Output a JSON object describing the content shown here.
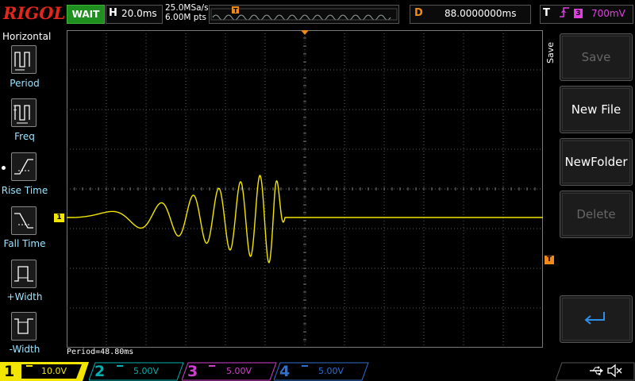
{
  "top_bar": {
    "logo": "RIGOL",
    "run_status": "WAIT",
    "h_label": "H",
    "timebase": "20.0ms",
    "sample_rate": "25.0MSa/s",
    "mem_depth": "6.00M pts",
    "d_label": "D",
    "delay": "88.0000000ms",
    "trigger_label": "T",
    "trigger_source": "3",
    "trigger_level": "700mV"
  },
  "left_menu": {
    "title": "Horizontal",
    "items": [
      {
        "label": "Period"
      },
      {
        "label": "Freq"
      },
      {
        "label": "Rise Time"
      },
      {
        "label": "Fall Time"
      },
      {
        "label": "+Width"
      },
      {
        "label": "-Width"
      }
    ]
  },
  "right_menu": {
    "tab_label": "Save",
    "buttons": [
      {
        "label": "Save",
        "enabled": false
      },
      {
        "label": "New File",
        "enabled": true
      },
      {
        "label": "NewFolder",
        "enabled": true
      },
      {
        "label": "Delete",
        "enabled": false
      },
      {
        "label": "",
        "icon": "return-arrow-icon",
        "enabled": true
      }
    ]
  },
  "waveform": {
    "channel_marker": "1",
    "trigger_marker": "T"
  },
  "measurement": "Period=48.80ms",
  "channels": [
    {
      "num": "1",
      "scale": "10.0V",
      "active": true
    },
    {
      "num": "2",
      "scale": "5.00V",
      "active": false
    },
    {
      "num": "3",
      "scale": "5.00V",
      "active": false
    },
    {
      "num": "4",
      "scale": "5.00V",
      "active": false
    }
  ],
  "colors": {
    "ch1": "#f2e600",
    "ch2": "#00b0b0",
    "ch3": "#d040d0",
    "ch4": "#2f6fd0",
    "trigger": "#f28a1a",
    "brand": "#e1261c",
    "run_status": "#1f8f1f"
  },
  "icons": [
    "usb-icon",
    "speaker-mute-icon",
    "return-arrow-icon"
  ]
}
